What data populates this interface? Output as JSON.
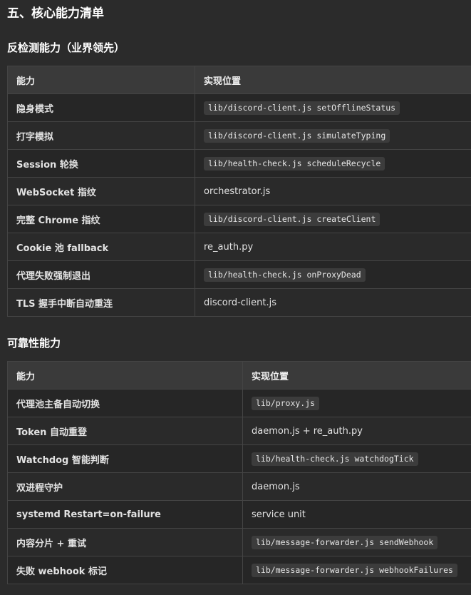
{
  "page_title": "五、核心能力清单",
  "sections": [
    {
      "title": "反检测能力（业界领先）",
      "headers": [
        "能力",
        "实现位置"
      ],
      "rows": [
        {
          "capability": "隐身模式",
          "location": "lib/discord-client.js setOfflineStatus",
          "code": true
        },
        {
          "capability": "打字模拟",
          "location": "lib/discord-client.js simulateTyping",
          "code": true
        },
        {
          "capability": "Session 轮换",
          "location": "lib/health-check.js scheduleRecycle",
          "code": true
        },
        {
          "capability": "WebSocket 指纹",
          "location": "orchestrator.js",
          "code": false
        },
        {
          "capability": "完整 Chrome 指纹",
          "location": "lib/discord-client.js createClient",
          "code": true
        },
        {
          "capability": "Cookie 池 fallback",
          "location": "re_auth.py",
          "code": false
        },
        {
          "capability": "代理失败强制退出",
          "location": "lib/health-check.js onProxyDead",
          "code": true
        },
        {
          "capability": "TLS 握手中断自动重连",
          "location": "discord-client.js",
          "code": false
        }
      ]
    },
    {
      "title": "可靠性能力",
      "headers": [
        "能力",
        "实现位置"
      ],
      "rows": [
        {
          "capability": "代理池主备自动切换",
          "location": "lib/proxy.js",
          "code": true
        },
        {
          "capability": "Token 自动重登",
          "location": "daemon.js + re_auth.py",
          "code": false
        },
        {
          "capability": "Watchdog 智能判断",
          "location": "lib/health-check.js watchdogTick",
          "code": true
        },
        {
          "capability": "双进程守护",
          "location": "daemon.js",
          "code": false
        },
        {
          "capability": "systemd Restart=on-failure",
          "location": "service unit",
          "code": false
        },
        {
          "capability": "内容分片 + 重试",
          "location": "lib/message-forwarder.js sendWebhook",
          "code": true
        },
        {
          "capability": "失败 webhook 标记",
          "location": "lib/message-forwarder.js webhookFailures",
          "code": true
        }
      ]
    }
  ]
}
